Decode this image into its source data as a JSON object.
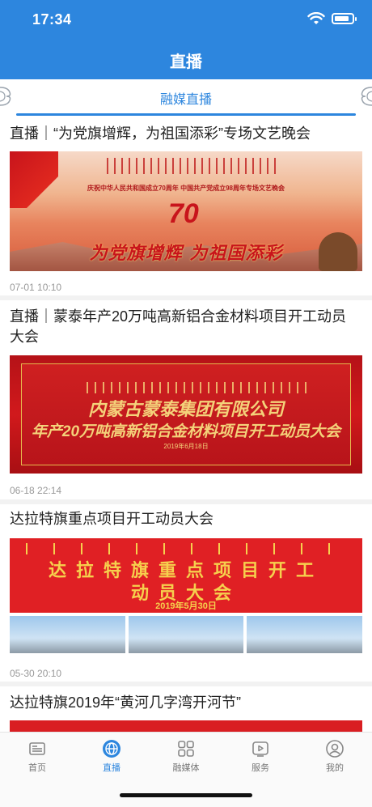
{
  "status_bar": {
    "time": "17:34"
  },
  "header": {
    "title": "直播"
  },
  "subtab": {
    "label": "融媒直播"
  },
  "feed": [
    {
      "title": "直播｜“为党旗增辉，为祖国添彩”专场文艺晚会",
      "time": "07-01 10:10",
      "image": {
        "subtitle": "庆祝中华人民共和国成立70周年 中国共产党成立98周年专场文艺晚会",
        "number": "70",
        "slogan": "为党旗增辉  为祖国添彩"
      }
    },
    {
      "title": "直播｜蒙泰年产20万吨高新铝合金材料项目开工动员大会",
      "time": "06-18 22:14",
      "image": {
        "line1": "内蒙古蒙泰集团有限公司",
        "line2": "年产20万吨高新铝合金材料项目开工动员大会",
        "line3": "2019年6月18日"
      }
    },
    {
      "title": "达拉特旗重点项目开工动员大会",
      "time": "05-30 20:10",
      "image": {
        "line1": "达拉特旗重点项目开工",
        "line2": "动员大会",
        "date": "2019年5月30日"
      }
    },
    {
      "title": "达拉特旗2019年“黄河几字湾开河节”"
    }
  ],
  "tabbar": {
    "tabs": [
      {
        "label": "首页",
        "icon": "news-icon",
        "active": false
      },
      {
        "label": "直播",
        "icon": "globe-icon",
        "active": true
      },
      {
        "label": "融媒体",
        "icon": "grid-icon",
        "active": false
      },
      {
        "label": "服务",
        "icon": "play-icon",
        "active": false
      },
      {
        "label": "我的",
        "icon": "profile-icon",
        "active": false
      }
    ]
  },
  "colors": {
    "primary": "#2d86de",
    "text": "#222222",
    "muted": "#999999"
  }
}
